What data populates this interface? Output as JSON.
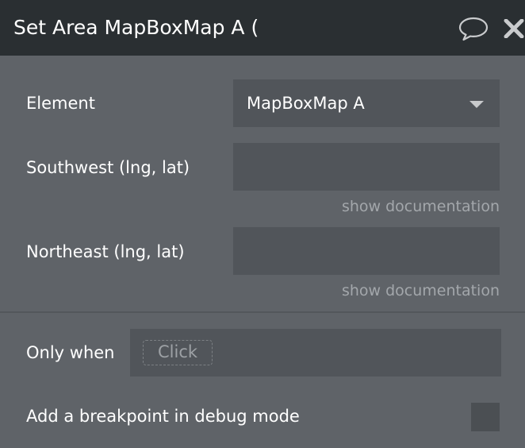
{
  "header": {
    "title": "Set Area MapBoxMap A (",
    "comment_icon": "speech-bubble-icon",
    "close_icon": "close-x-icon"
  },
  "form": {
    "element": {
      "label": "Element",
      "value": "MapBoxMap A"
    },
    "southwest": {
      "label": "Southwest (lng, lat)",
      "value": "",
      "doc_link": "show documentation"
    },
    "northeast": {
      "label": "Northeast (lng, lat)",
      "value": "",
      "doc_link": "show documentation"
    },
    "only_when": {
      "label": "Only when",
      "placeholder": "Click"
    },
    "breakpoint": {
      "label": "Add a breakpoint in debug mode",
      "checked": false
    }
  },
  "colors": {
    "header_bg": "#2a2f32",
    "panel_bg": "#5f6368",
    "field_bg": "#51555a",
    "muted_text": "#a3a7ab"
  }
}
